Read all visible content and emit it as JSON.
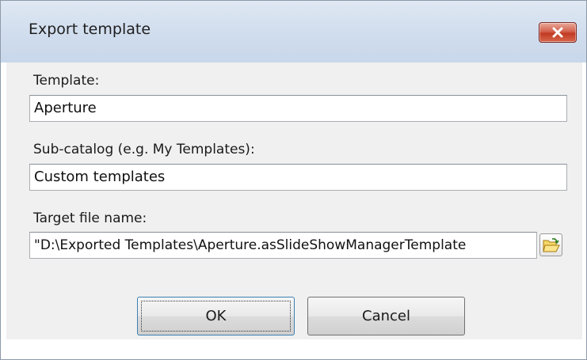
{
  "window": {
    "title": "Export template"
  },
  "form": {
    "template_label": "Template:",
    "template_value": "Aperture",
    "subcatalog_label": "Sub-catalog (e.g. My Templates):",
    "subcatalog_value": "Custom templates",
    "target_label": "Target file name:",
    "target_value": "\"D:\\Exported Templates\\Aperture.asSlideShowManagerTemplate"
  },
  "buttons": {
    "ok": "OK",
    "cancel": "Cancel"
  },
  "icons": {
    "close": "close-icon",
    "browse": "open-folder-icon"
  },
  "colors": {
    "close_button": "#c8412a",
    "titlebar": "#d5e1ef",
    "client_bg": "#f0f0f0",
    "focus_border": "#3c7fb1"
  }
}
